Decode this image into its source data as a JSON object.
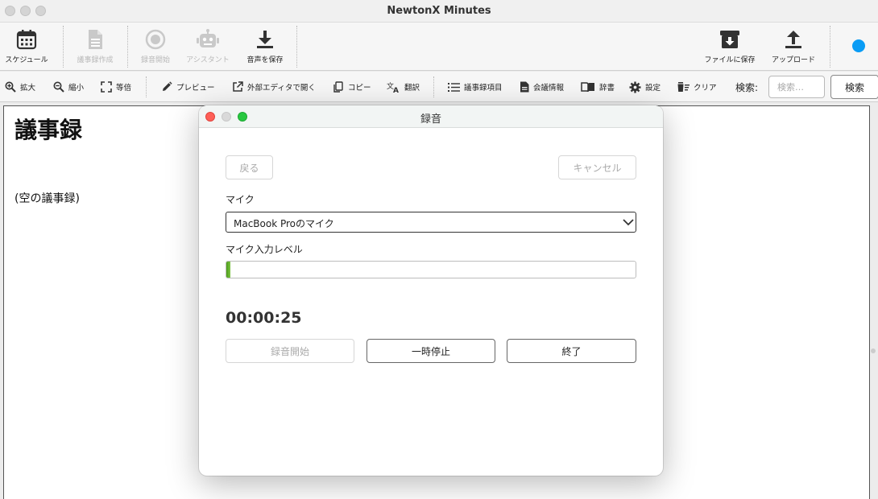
{
  "window": {
    "title": "NewtonX Minutes"
  },
  "toolbar": {
    "schedule": "スケジュール",
    "minutes_create": "議事録作成",
    "record_start": "録音開始",
    "assistant": "アシスタント",
    "save_audio": "音声を保存",
    "save_file": "ファイルに保存",
    "upload": "アップロード"
  },
  "toolbar2": {
    "zoom_in": "拡大",
    "zoom_out": "縮小",
    "actual_size": "等倍",
    "preview": "プレビュー",
    "open_external": "外部エディタで開く",
    "copy": "コピー",
    "translate": "翻訳",
    "minutes_items": "議事録項目",
    "meeting_info": "会議情報",
    "dictionary": "辞書",
    "settings": "設定",
    "clear": "クリア",
    "search_label": "検索:",
    "search_placeholder": "検索…",
    "search_button": "検索"
  },
  "document": {
    "title": "議事録",
    "empty_text": "(空の議事録)"
  },
  "dialog": {
    "title": "録音",
    "back": "戻る",
    "cancel": "キャンセル",
    "mic_label": "マイク",
    "mic_selected": "MacBook Proのマイク",
    "level_label": "マイク入力レベル",
    "level_fraction": 0.01,
    "timer": "00:00:25",
    "start": "録音開始",
    "pause": "一時停止",
    "stop": "終了"
  },
  "colors": {
    "accent_blue": "#0a9cf5",
    "close_red": "#fe5f57",
    "minimize": "#d9d9d9",
    "maximize_green": "#28c840",
    "level_green": "#4b9b1a"
  }
}
